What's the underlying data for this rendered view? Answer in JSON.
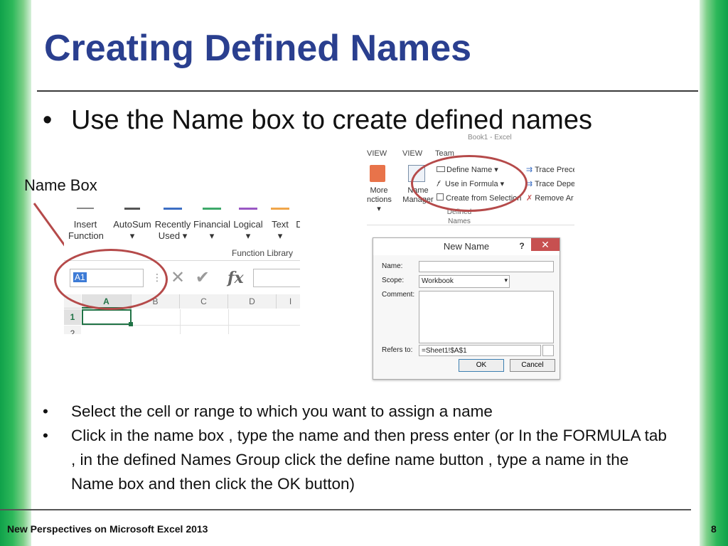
{
  "slide": {
    "title": "Creating Defined Names",
    "main_bullet": "Use the Name box to create defined names",
    "callout_label": "Name Box",
    "sub_bullets": [
      "Select the cell or range to which you want to assign a name",
      "Click in the name box , type the name and then press enter (or In the FORMULA tab , in the defined Names Group click the define name button , type a name in the Name box and then click the OK button)"
    ],
    "bullet_symbol": "•",
    "footer": "New Perspectives on Microsoft Excel 2013",
    "page_number": "8"
  },
  "left_screenshot": {
    "ribbon_buttons": [
      {
        "line1": "Insert",
        "line2": "Function"
      },
      {
        "line1": "AutoSum",
        "line2": "▾"
      },
      {
        "line1": "Recently",
        "line2": "Used ▾"
      },
      {
        "line1": "Financial",
        "line2": "▾"
      },
      {
        "line1": "Logical",
        "line2": "▾"
      },
      {
        "line1": "Text",
        "line2": "▾"
      },
      {
        "line1": "D",
        "line2": ""
      }
    ],
    "group_label": "Function Library",
    "name_box_value": "A1",
    "formula_sep": "⋮",
    "cancel_symbol": "✕",
    "enter_symbol": "✔",
    "fx_label": "fx",
    "columns": [
      "A",
      "B",
      "C",
      "D",
      "I"
    ],
    "rows": [
      "1",
      "2"
    ]
  },
  "right_screenshot": {
    "window_title": "Book1 - Excel",
    "tabs": [
      "VIEW",
      "VIEW",
      "Team"
    ],
    "more_functions": {
      "line1": "More",
      "line2": "nctions ▾"
    },
    "name_manager": {
      "line1": "Name",
      "line2": "Manager"
    },
    "defined_names_items": [
      "Define Name ▾",
      "Use in Formula ▾",
      "Create from Selection"
    ],
    "group_label": "Defined Names",
    "auditing_items": [
      "Trace Prece",
      "Trace Depe",
      "Remove Ar"
    ],
    "dialog": {
      "title": "New Name",
      "help": "?",
      "close": "✕",
      "name_label": "Name:",
      "scope_label": "Scope:",
      "scope_value": "Workbook",
      "comment_label": "Comment:",
      "refers_label": "Refers to:",
      "refers_value": "=Sheet1!$A$1",
      "ok_label": "OK",
      "cancel_label": "Cancel"
    }
  },
  "colors": {
    "title": "#2a3f8f",
    "side_green": "#0fa14a",
    "callout_red": "#b54a4a",
    "excel_green": "#217346"
  }
}
